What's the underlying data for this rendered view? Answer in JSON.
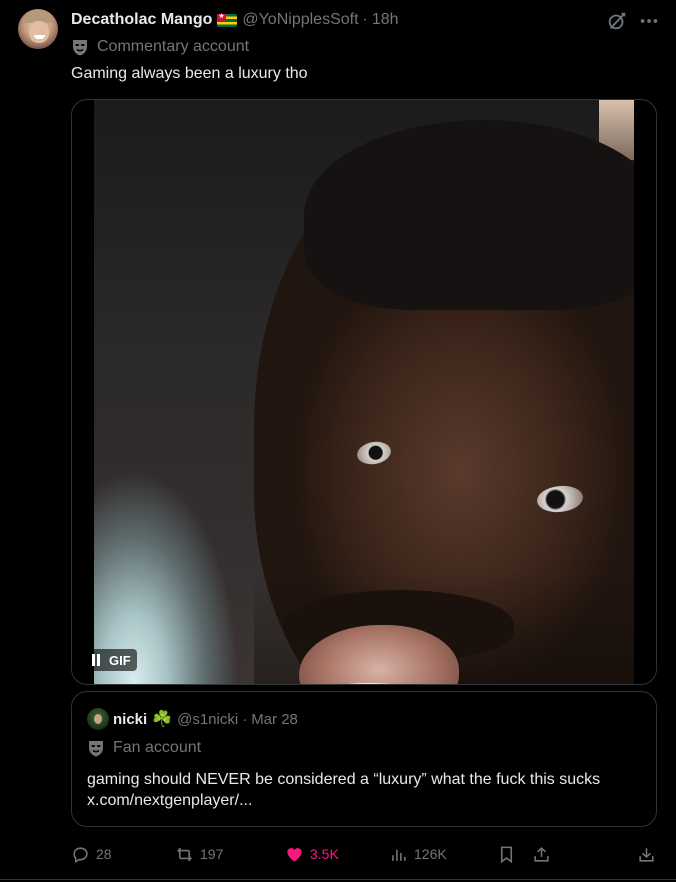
{
  "post": {
    "author": {
      "display_name": "Decatholac Mango",
      "flag": "Togo flag",
      "handle": "@YoNipplesSoft",
      "separator": "·",
      "time": "18h"
    },
    "label": "Commentary account",
    "text": "Gaming always been a luxury tho",
    "media": {
      "type": "gif",
      "badge": "GIF",
      "pause_icon": "pause-icon"
    },
    "icons": {
      "grok": "grok-icon",
      "more": "more-icon"
    }
  },
  "quote": {
    "author": {
      "display_name": "nicki",
      "emoji": "☘️",
      "handle": "@s1nicki",
      "separator": "·",
      "time": "Mar 28"
    },
    "label": "Fan account",
    "text": "gaming should NEVER be considered a “luxury” what the fuck this sucks x.com/nextgenplayer/..."
  },
  "actions": {
    "replies": "28",
    "reposts": "197",
    "likes": "3.5K",
    "views": "126K",
    "colors": {
      "muted": "#71767b",
      "like": "#f91880"
    }
  }
}
